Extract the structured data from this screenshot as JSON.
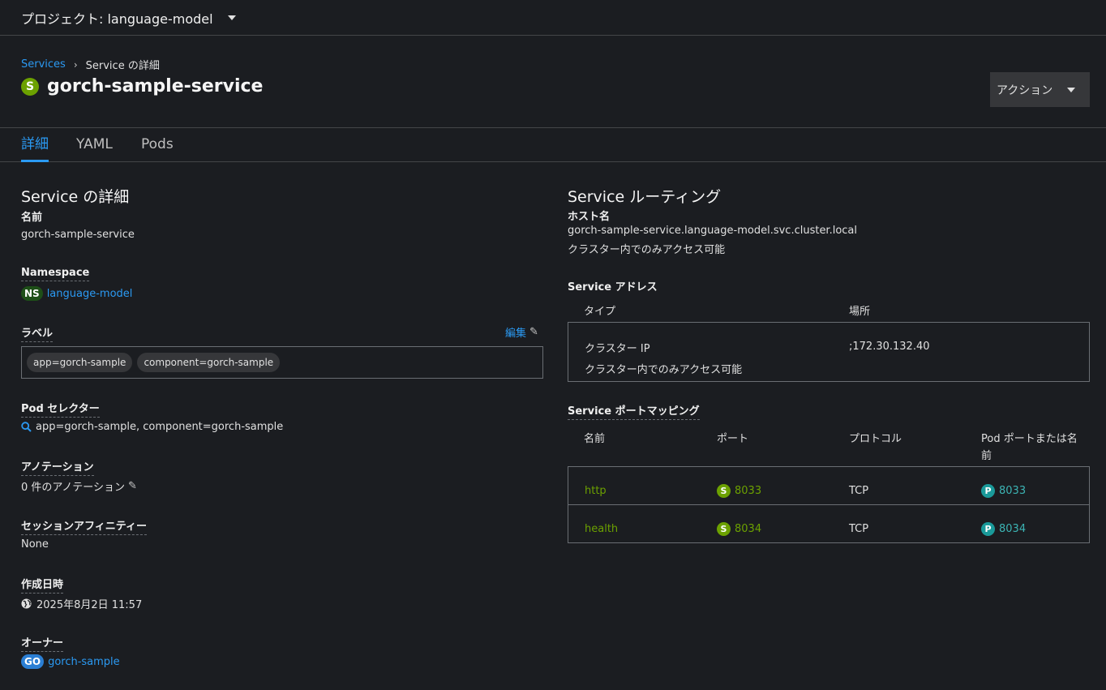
{
  "project": {
    "label": "プロジェクト: language-model"
  },
  "breadcrumb": {
    "parent": "Services",
    "separator": "›",
    "current": "Service の詳細"
  },
  "header": {
    "badge": "S",
    "title": "gorch-sample-service",
    "actions_label": "アクション"
  },
  "tabs": [
    {
      "label": "詳細"
    },
    {
      "label": "YAML"
    },
    {
      "label": "Pods"
    }
  ],
  "details": {
    "section_title": "Service の詳細",
    "name_label": "名前",
    "name_value": "gorch-sample-service",
    "namespace_label": "Namespace",
    "namespace_badge": "NS",
    "namespace_value": "language-model",
    "labels_label": "ラベル",
    "edit_label": "編集",
    "labels": [
      "app=gorch-sample",
      "component=gorch-sample"
    ],
    "pod_selector_label": "Pod セレクター",
    "pod_selector_value": "app=gorch-sample, component=gorch-sample",
    "annotations_label": "アノテーション",
    "annotations_value": "0 件のアノテーション",
    "session_affinity_label": "セッションアフィニティー",
    "session_affinity_value": "None",
    "created_label": "作成日時",
    "created_value": "2025年8月2日 11:57",
    "owner_label": "オーナー",
    "owner_badge": "GO",
    "owner_value": "gorch-sample"
  },
  "routing": {
    "section_title": "Service ルーティング",
    "hostname_label": "ホスト名",
    "hostname_value": "gorch-sample-service.language-model.svc.cluster.local",
    "hostname_note": "クラスター内でのみアクセス可能",
    "address_label": "Service アドレス",
    "address_headers": {
      "type": "タイプ",
      "location": "場所"
    },
    "address_row": {
      "type": "クラスター IP",
      "type_note": "クラスター内でのみアクセス可能",
      "location": ";172.30.132.40"
    },
    "port_mapping_label": "Service ポートマッピング",
    "port_headers": {
      "name": "名前",
      "port": "ポート",
      "protocol": "プロトコル",
      "pod_port_line1": "Pod ポートまたは名",
      "pod_port_line2": "前"
    },
    "ports": [
      {
        "name": "http",
        "port_badge": "S",
        "port": "8033",
        "protocol": "TCP",
        "pod_badge": "P",
        "pod_port": "8033"
      },
      {
        "name": "health",
        "port_badge": "S",
        "port": "8034",
        "protocol": "TCP",
        "pod_badge": "P",
        "pod_port": "8034"
      }
    ]
  },
  "colors": {
    "accent": "#2b9af3",
    "service_badge": "#6ca100",
    "pod_badge": "#1a9a9a",
    "background": "#1b1d21"
  },
  "icons": {
    "caret": "caret-down-icon",
    "pencil": "pencil-icon",
    "search": "search-icon",
    "globe": "globe-icon"
  }
}
